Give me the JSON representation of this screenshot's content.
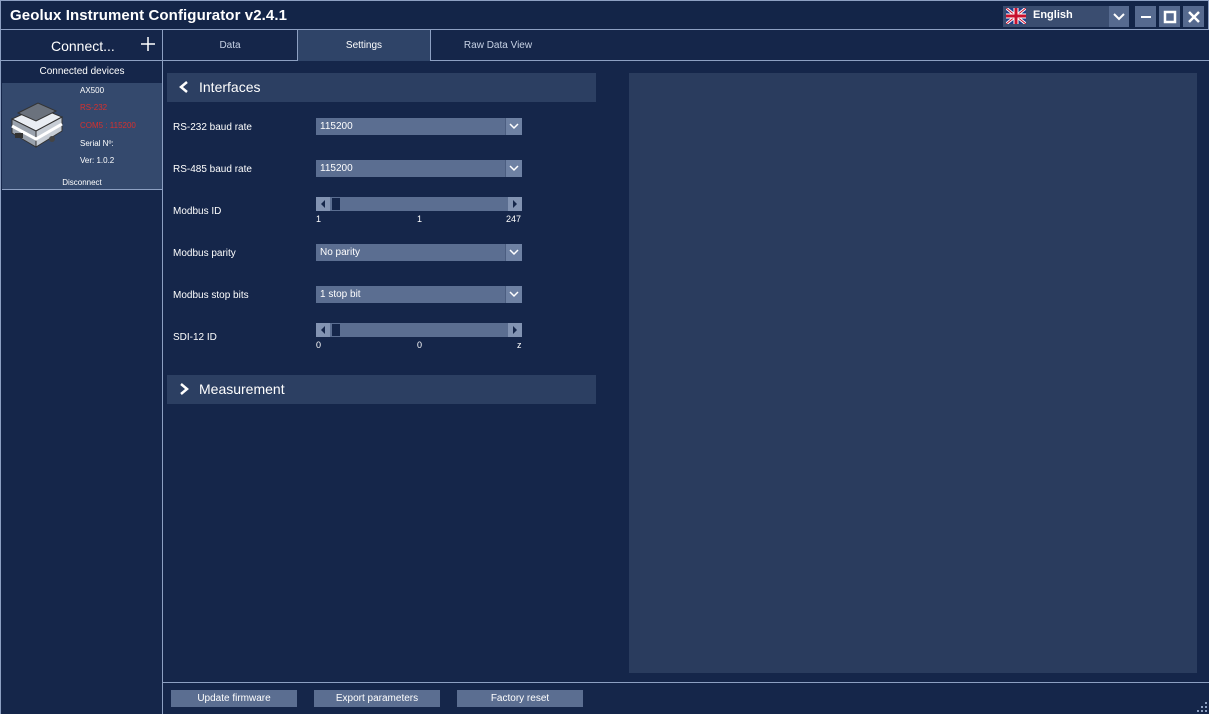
{
  "window": {
    "title": "Geolux Instrument Configurator v2.4.1",
    "language": "English"
  },
  "sidebar": {
    "connect_label": "Connect...",
    "connected_title": "Connected devices",
    "device": {
      "model": "AX500",
      "interface": "RS-232",
      "port": "COM5 : 115200",
      "serial": "Serial Nº:",
      "version": "Ver: 1.0.2"
    },
    "disconnect_label": "Disconnect"
  },
  "tabs": [
    {
      "label": "Data"
    },
    {
      "label": "Settings"
    },
    {
      "label": "Raw Data View"
    }
  ],
  "interfaces": {
    "header": "Interfaces",
    "rs232": {
      "label": "RS-232 baud rate",
      "value": "115200"
    },
    "rs485": {
      "label": "RS-485 baud rate",
      "value": "115200"
    },
    "modbus_id": {
      "label": "Modbus ID",
      "min": "1",
      "value": "1",
      "max": "247"
    },
    "modbus_parity": {
      "label": "Modbus parity",
      "value": "No parity"
    },
    "modbus_stop": {
      "label": "Modbus stop bits",
      "value": "1 stop bit"
    },
    "sdi12": {
      "label": "SDI-12 ID",
      "min": "0",
      "value": "0",
      "max": "z"
    }
  },
  "measurement": {
    "header": "Measurement"
  },
  "footer": {
    "update_firmware": "Update firmware",
    "export_parameters": "Export parameters",
    "factory_reset": "Factory reset"
  },
  "colors": {
    "background": "#15264a",
    "panel": "#2a3c5e",
    "control": "#5b6e91",
    "warning_text": "#d8302d"
  }
}
